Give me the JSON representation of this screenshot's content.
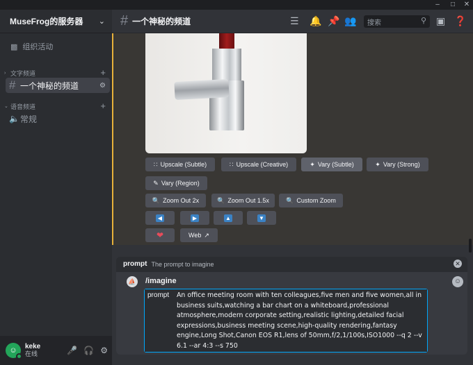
{
  "window": {
    "minimize": "–",
    "maximize": "□",
    "close": "✕"
  },
  "server": {
    "name": "MuseFrog的服务器"
  },
  "sidebar": {
    "events_label": "组织活动",
    "text_category": "文字频道",
    "active_channel": "一个神秘的频道",
    "voice_category": "语音频道",
    "voice_channel": "常规"
  },
  "user": {
    "name": "keke",
    "status": "在线"
  },
  "header": {
    "channel": "一个神秘的频道",
    "search_placeholder": "搜索"
  },
  "buttons": {
    "upscale_subtle": "Upscale (Subtle)",
    "upscale_creative": "Upscale (Creative)",
    "vary_subtle": "Vary (Subtle)",
    "vary_strong": "Vary (Strong)",
    "vary_region": "Vary (Region)",
    "zoom_out_2x": "Zoom Out 2x",
    "zoom_out_15x": "Zoom Out 1.5x",
    "custom_zoom": "Custom Zoom",
    "web": "Web"
  },
  "composer": {
    "option_name": "prompt",
    "option_desc": "The prompt to imagine",
    "command": "/imagine",
    "field_label": "prompt",
    "field_value": "An office meeting room with ten colleagues,five men and five women,all in business suits,watching a bar chart on a whiteboard,professional atmosphere,modern corporate setting,realistic lighting,detailed facial expressions,business meeting scene,high-quality rendering,fantasy engine,Long Shot,Canon EOS R1,lens of 50mm,f/2,1/100s,ISO1000 --q 2 --v 6.1 --ar 4:3 --s 750"
  }
}
